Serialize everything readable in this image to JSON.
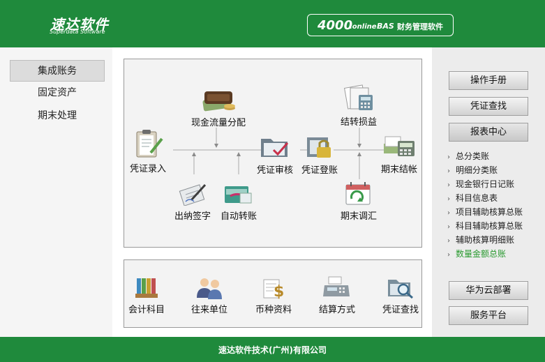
{
  "header": {
    "logo": "速达软件",
    "logo_sub": "Superdata Software",
    "product_num": "4000",
    "product_online": ".online",
    "product_bas": "BAS",
    "product_desc": "财务管理软件"
  },
  "left_nav": [
    "集成账务",
    "固定资产",
    "期末处理"
  ],
  "flow": {
    "cash_flow": "现金流量分配",
    "transfer_pl": "结转损益",
    "voucher_entry": "凭证录入",
    "voucher_audit": "凭证审核",
    "voucher_post": "凭证登账",
    "period_close": "期末结帐",
    "cashier_sign": "出纳签字",
    "auto_transfer": "自动转账",
    "period_adjust": "期末调汇"
  },
  "base": {
    "accounts": "会计科目",
    "partners": "往来单位",
    "currency": "币种资料",
    "settlement": "结算方式",
    "voucher_search": "凭证查找"
  },
  "right": {
    "manual": "操作手册",
    "voucher_search": "凭证查找",
    "report_center": "报表中心",
    "reports": [
      "总分类账",
      "明细分类账",
      "现金银行日记账",
      "科目信息表",
      "项目辅助核算总账",
      "科目辅助核算总账",
      "辅助核算明细账",
      "数量金额总账"
    ],
    "huawei": "华为云部署",
    "service": "服务平台"
  },
  "footer": "速达软件技术(广州)有限公司",
  "colors": {
    "brand_green": "#1f8a3c",
    "highlight_green": "#2a9a30"
  }
}
